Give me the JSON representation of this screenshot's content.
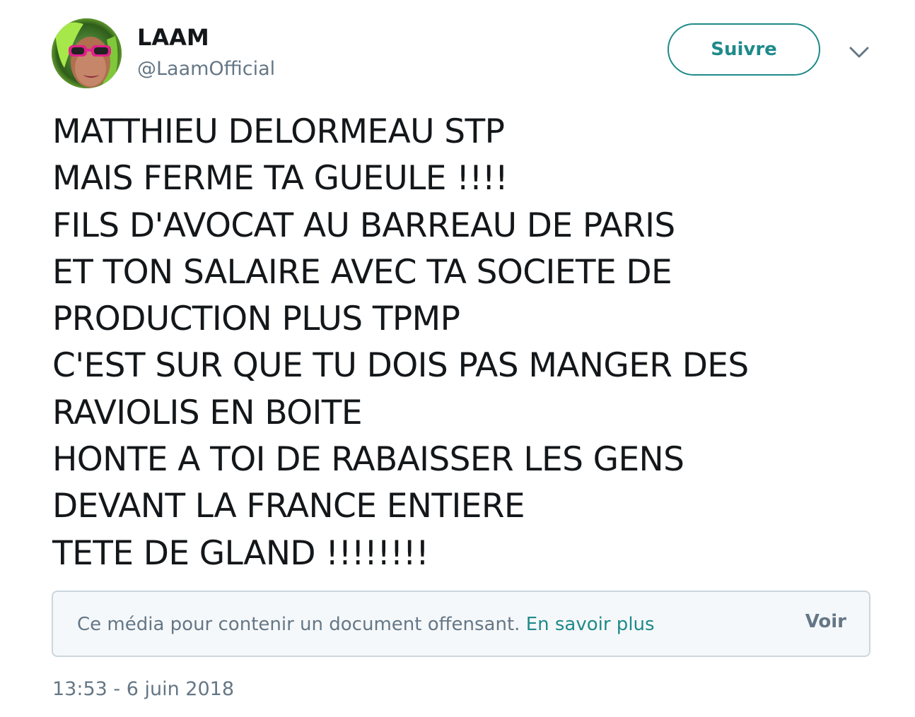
{
  "author": {
    "display_name": "LAAM",
    "handle": "@LaamOfficial"
  },
  "follow_button": {
    "label": "Suivre"
  },
  "menu": {
    "icon": "chevron-down-icon"
  },
  "tweet": {
    "lines": [
      "MATTHIEU DELORMEAU STP",
      "MAIS FERME TA GUEULE !!!!",
      "FILS D'AVOCAT AU BARREAU DE PARIS",
      "ET TON SALAIRE AVEC TA SOCIETE DE",
      "PRODUCTION PLUS TPMP",
      "C'EST SUR QUE TU DOIS PAS MANGER DES",
      "RAVIOLIS EN BOITE",
      "HONTE A TOI DE RABAISSER LES GENS",
      "DEVANT LA FRANCE ENTIERE",
      "TETE DE GLAND !!!!!!!!"
    ]
  },
  "sensitive_media": {
    "warning": "Ce média pour contenir un document offensant.",
    "learn_more": "En savoir plus",
    "view_label": "Voir"
  },
  "timestamp": "13:53 - 6 juin 2018",
  "colors": {
    "accent": "#1f8a8a",
    "text": "#14171a",
    "muted": "#657786",
    "border": "#ccd6dd",
    "box_bg": "#f5f8fa"
  }
}
